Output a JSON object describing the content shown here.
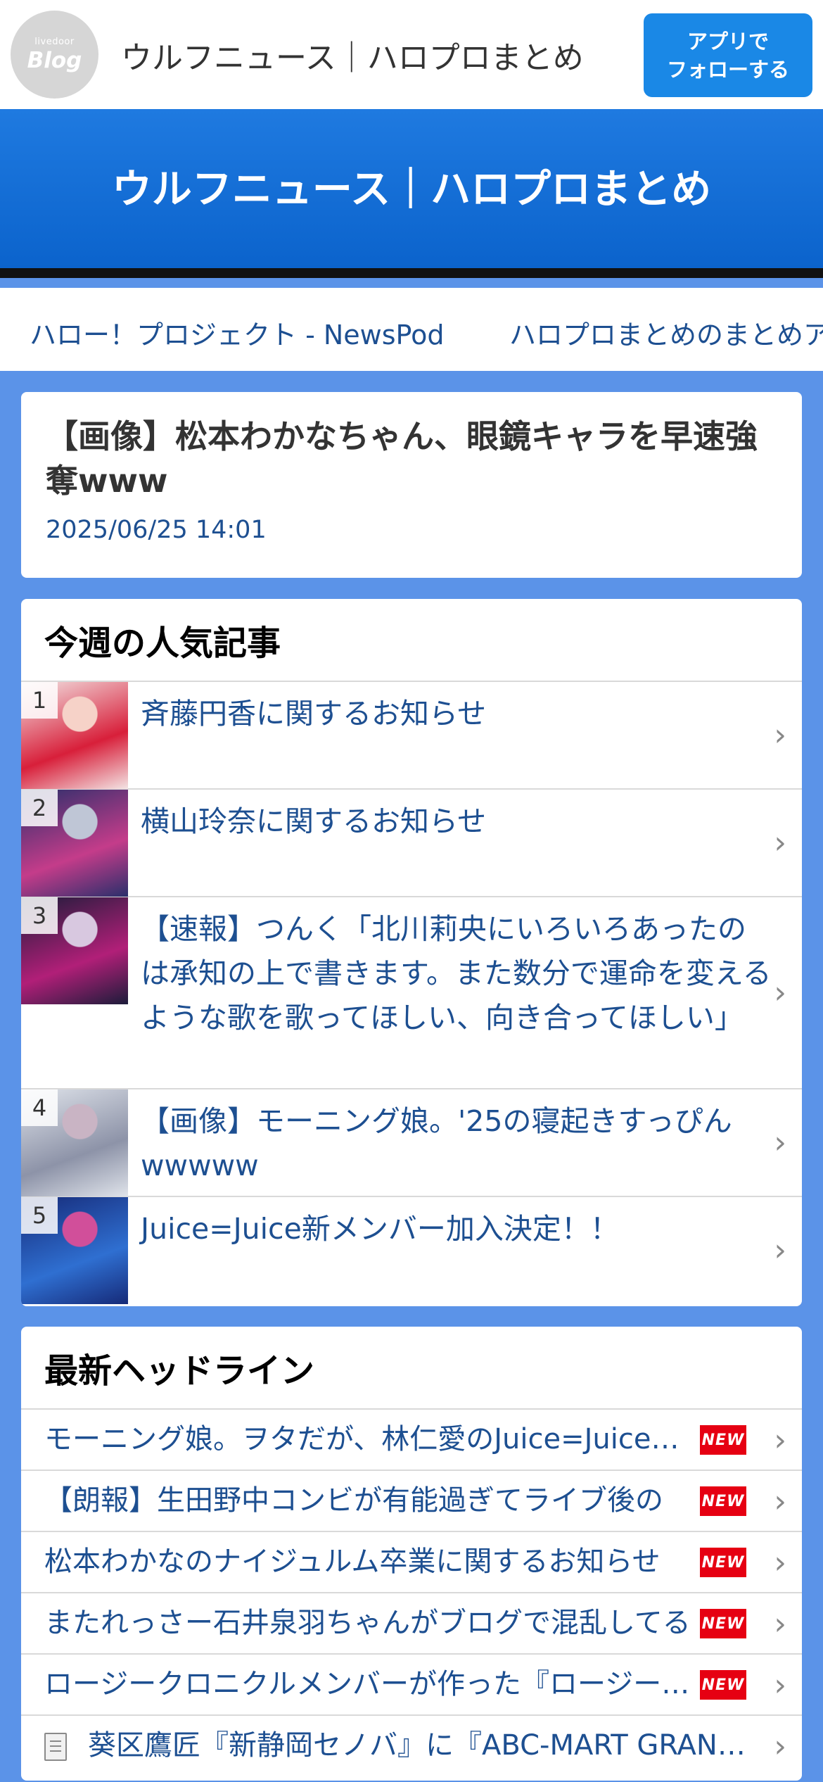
{
  "topbar": {
    "logo_small": "livedoor",
    "logo_big": "Blog",
    "site_name": "ウルフニュース｜ハロプロまとめ",
    "follow_line1": "アプリで",
    "follow_line2": "フォローする"
  },
  "header": {
    "title": "ウルフニュース｜ハロプロまとめ"
  },
  "links": [
    "ハロー！プロジェクト - NewsPod",
    "ハロプロまとめのまとめア"
  ],
  "article": {
    "title": "【画像】松本わかなちゃん、眼鏡キャラを早速強奪www",
    "date": "2025/06/25 14:01"
  },
  "ranking": {
    "heading": "今週の人気記事",
    "items": [
      {
        "rank": "1",
        "title": "斉藤円香に関するお知らせ",
        "thumb_colors": [
          "#f3e4e4",
          "#d81f3a",
          "#f6d2c8"
        ]
      },
      {
        "rank": "2",
        "title": "横山玲奈に関するお知らせ",
        "thumb_colors": [
          "#2a2f6b",
          "#c43c8a",
          "#bfc6d6"
        ]
      },
      {
        "rank": "3",
        "title": "【速報】つんく「北川莉央にいろいろあったのは承知の上で書きます。また数分で運命を変えるような歌を歌ってほしい、向き合ってほしい」",
        "thumb_colors": [
          "#1c1c3a",
          "#b11f78",
          "#d8c8e0"
        ]
      },
      {
        "rank": "4",
        "title": "【画像】モーニング娘。'25の寝起きすっぴんwwwww",
        "thumb_colors": [
          "#dfe3ea",
          "#8d93a8",
          "#c9b4c4"
        ]
      },
      {
        "rank": "5",
        "title": "Juice=Juice新メンバー加入決定！！",
        "thumb_colors": [
          "#162a78",
          "#2f6fd1",
          "#d14f9a"
        ]
      }
    ]
  },
  "headlines": {
    "heading": "最新ヘッドライン",
    "badge": "NEW",
    "items": [
      {
        "title": "モーニング娘。ヲタだが、林仁愛のJuice=Juice加入",
        "new": true
      },
      {
        "title": "【朗報】生田野中コンビが有能過ぎてライブ後の",
        "new": true
      },
      {
        "title": "松本わかなのナイジュルム卒業に関するお知らせ",
        "new": true
      },
      {
        "title": "またれっさー石井泉羽ちゃんがブログで混乱してる",
        "new": true
      },
      {
        "title": "ロージークロニクルメンバーが作った『ロージークロ",
        "new": true
      },
      {
        "title": "葵区鷹匠『新静岡セノバ』に『ABC-MART GRAND STAGE』",
        "new": false
      }
    ]
  }
}
